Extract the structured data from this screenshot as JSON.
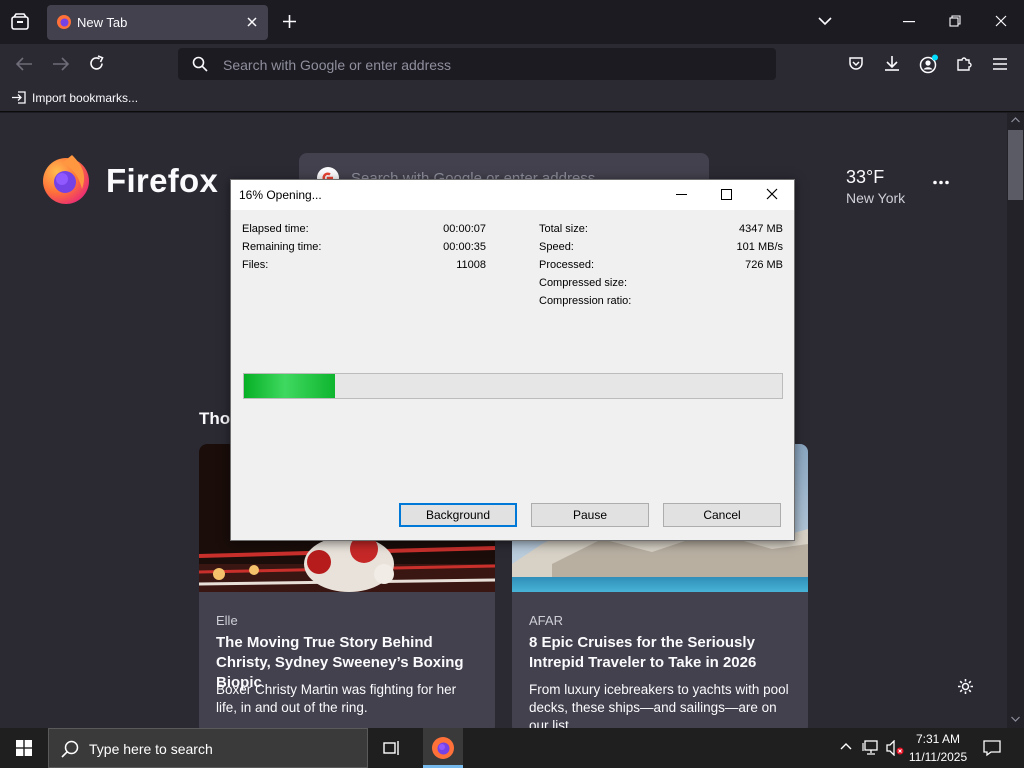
{
  "browser": {
    "tab_title": "New Tab",
    "url_placeholder": "Search with Google or enter address",
    "bookmarks_item": "Import bookmarks..."
  },
  "newtab": {
    "brand": "Firefox",
    "search_placeholder": "Search with Google or enter address",
    "weather_temp": "33°F",
    "weather_city": "New York",
    "section_partial": "Tho",
    "cards": [
      {
        "source": "Elle",
        "headline": "The Moving True Story Behind Christy, Sydney Sweeney’s Boxing Biopic",
        "excerpt": "Boxer Christy Martin was fighting for her life, in and out of the ring."
      },
      {
        "source": "AFAR",
        "headline": "8 Epic Cruises for the Seriously Intrepid Traveler to Take in 2026",
        "excerpt": "From luxury icebreakers to yachts with pool decks, these ships—and sailings—are on our list."
      }
    ]
  },
  "dialog": {
    "title": "16% Opening...",
    "progress_fraction": 0.17,
    "left_stats": [
      {
        "label": "Elapsed time:",
        "value": "00:00:07"
      },
      {
        "label": "Remaining time:",
        "value": "00:00:35"
      },
      {
        "label": "Files:",
        "value": "11008"
      }
    ],
    "right_stats": [
      {
        "label": "Total size:",
        "value": "4347 MB"
      },
      {
        "label": "Speed:",
        "value": "101 MB/s"
      },
      {
        "label": "Processed:",
        "value": "726 MB"
      },
      {
        "label": "Compressed size:",
        "value": ""
      },
      {
        "label": "Compression ratio:",
        "value": ""
      }
    ],
    "buttons": {
      "background": "Background",
      "pause": "Pause",
      "cancel": "Cancel"
    }
  },
  "taskbar": {
    "search_placeholder": "Type here to search",
    "time": "7:31 AM",
    "date": "11/11/2025"
  },
  "colors": {
    "progress_green": "#06b025",
    "firefox_orange": "#ff7139",
    "firefox_purple": "#7542e5",
    "accent_blue": "#0078d7"
  }
}
